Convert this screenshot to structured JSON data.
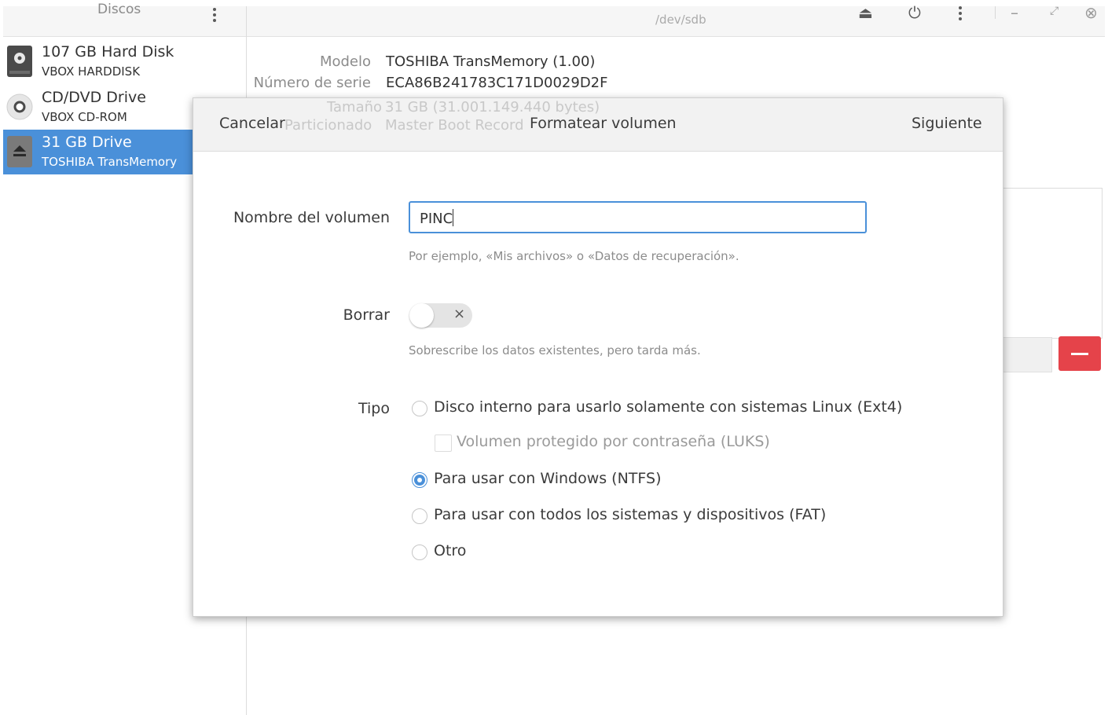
{
  "sidebar": {
    "title": "Discos",
    "drives": [
      {
        "name": "107 GB Hard Disk",
        "sub": "VBOX HARDDISK"
      },
      {
        "name": "CD/DVD Drive",
        "sub": "VBOX CD-ROM"
      },
      {
        "name": "31 GB Drive",
        "sub": "TOSHIBA TransMemory"
      }
    ]
  },
  "main": {
    "title": "/dev/sdb",
    "info": {
      "model_label": "Modelo",
      "model_value": "TOSHIBA TransMemory (1.00)",
      "serial_label": "Número de serie",
      "serial_value": "ECA86B241783C171D0029D2F",
      "size_label": "Tamaño",
      "size_value": "31 GB (31.001.149.440 bytes)",
      "partition_label": "Particionado",
      "partition_value": "Master Boot Record"
    }
  },
  "dialog": {
    "cancel_label": "Cancelar",
    "title": "Formatear volumen",
    "next_label": "Siguiente",
    "volume_name_label": "Nombre del volumen",
    "volume_name_value": "PINC",
    "volume_name_hint": "Por ejemplo, «Mis archivos» o «Datos de recuperación».",
    "erase_label": "Borrar",
    "erase_hint": "Sobrescribe los datos existentes, pero tarda más.",
    "type_label": "Tipo",
    "options": [
      {
        "label": "Disco interno para usarlo solamente con sistemas Linux (Ext4)",
        "selected": false
      },
      {
        "label": "Para usar con Windows (NTFS)",
        "selected": true
      },
      {
        "label": "Para usar con todos los sistemas y dispositivos (FAT)",
        "selected": false
      },
      {
        "label": "Otro",
        "selected": false
      }
    ],
    "luks_label": "Volumen protegido por contraseña (LUKS)"
  },
  "colors": {
    "accent": "#4a90d9",
    "destructive": "#e5434a"
  }
}
